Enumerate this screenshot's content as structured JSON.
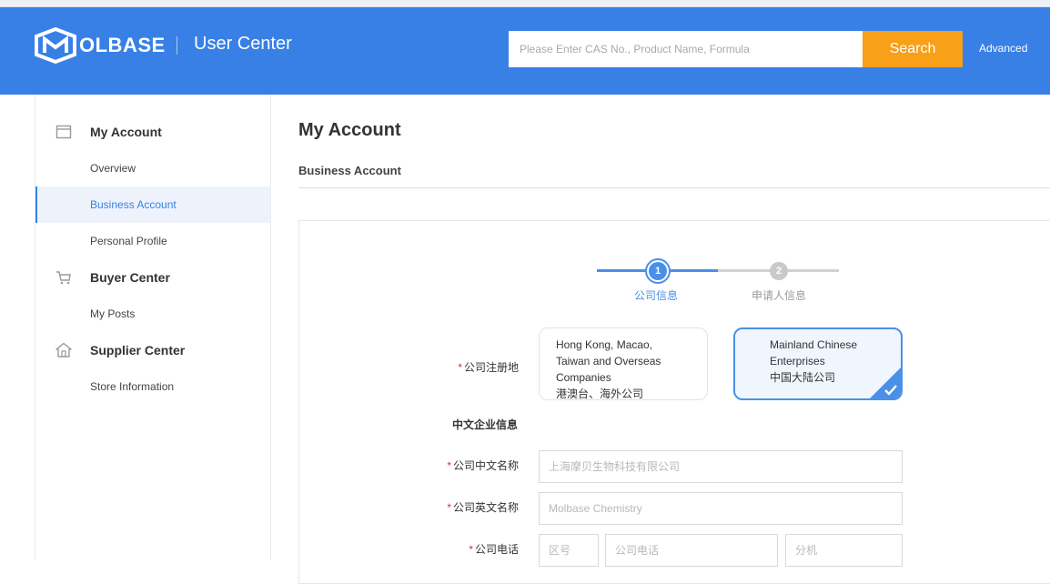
{
  "header": {
    "logo_text": "OLBASE",
    "title": "User Center",
    "search_placeholder": "Please Enter CAS No., Product Name, Formula",
    "search_label": "Search",
    "advanced_label": "Advanced"
  },
  "sidebar": {
    "sections": [
      {
        "title": "My Account",
        "icon": "account-icon",
        "items": [
          "Overview",
          "Business Account",
          "Personal Profile"
        ]
      },
      {
        "title": "Buyer Center",
        "icon": "cart-icon",
        "items": [
          "My Posts"
        ]
      },
      {
        "title": "Supplier Center",
        "icon": "store-icon",
        "items": [
          "Store Information"
        ]
      }
    ],
    "active_item": "Business Account"
  },
  "main": {
    "title": "My Account",
    "subtitle": "Business Account"
  },
  "steps": [
    {
      "number": "1",
      "label": "公司信息",
      "state": "active"
    },
    {
      "number": "2",
      "label": "申请人信息",
      "state": "inactive"
    }
  ],
  "form": {
    "registration_label": "公司注册地",
    "options": [
      {
        "line1": "Hong Kong, Macao,",
        "line2": "Taiwan and Overseas",
        "line3": "Companies",
        "line4": "港澳台、海外公司",
        "selected": false
      },
      {
        "line1": "Mainland Chinese",
        "line2": "Enterprises",
        "line3": "中国大陆公司",
        "selected": true
      }
    ],
    "section_title": "中文企业信息",
    "cn_name_label": "公司中文名称",
    "cn_name_placeholder": "上海摩贝生物科技有限公司",
    "en_name_label": "公司英文名称",
    "en_name_placeholder": "Molbase Chemistry",
    "phone_label": "公司电话",
    "area_code_placeholder": "区号",
    "phone_placeholder": "公司电话",
    "ext_placeholder": "分机"
  },
  "colors": {
    "header_bg": "#3880e6",
    "search_button": "#f8a018",
    "accent": "#3880e6",
    "required": "#e0302a"
  }
}
